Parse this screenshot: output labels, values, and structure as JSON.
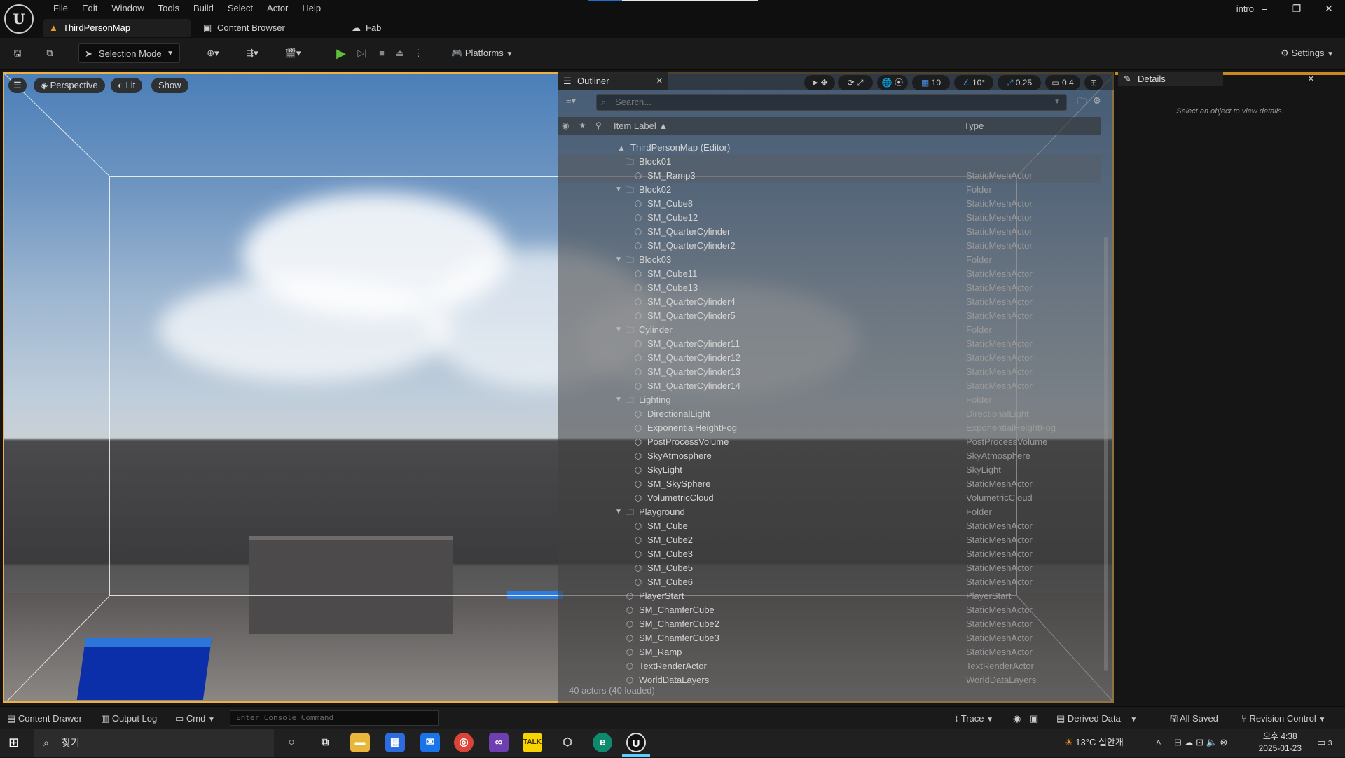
{
  "menu": [
    "File",
    "Edit",
    "Window",
    "Tools",
    "Build",
    "Select",
    "Actor",
    "Help"
  ],
  "tabs": {
    "map": "ThirdPersonMap",
    "content_browser": "Content Browser",
    "fab": "Fab"
  },
  "project_name": "intro",
  "toolbar": {
    "selection_mode": "Selection Mode",
    "platforms": "Platforms",
    "settings": "Settings"
  },
  "viewport": {
    "perspective": "Perspective",
    "lit": "Lit",
    "show": "Show"
  },
  "snap": {
    "grid": "10",
    "rotation": "10°",
    "scale": "0.25",
    "camera_speed": "0.4"
  },
  "outliner": {
    "title": "Outliner",
    "search_placeholder": "Search...",
    "col_label": "Item Label ▲",
    "col_type": "Type",
    "footer": "40 actors (40 loaded)",
    "rows": [
      {
        "label": "ThirdPersonMap (Editor)",
        "type": ""
      },
      {
        "label": "Block01",
        "type": ""
      },
      {
        "label": "SM_Ramp3",
        "type": "StaticMeshActor"
      },
      {
        "label": "Block02",
        "type": "Folder"
      },
      {
        "label": "SM_Cube8",
        "type": "StaticMeshActor"
      },
      {
        "label": "SM_Cube12",
        "type": "StaticMeshActor"
      },
      {
        "label": "SM_QuarterCylinder",
        "type": "StaticMeshActor"
      },
      {
        "label": "SM_QuarterCylinder2",
        "type": "StaticMeshActor"
      },
      {
        "label": "Block03",
        "type": "Folder"
      },
      {
        "label": "SM_Cube11",
        "type": "StaticMeshActor"
      },
      {
        "label": "SM_Cube13",
        "type": "StaticMeshActor"
      },
      {
        "label": "SM_QuarterCylinder4",
        "type": "StaticMeshActor"
      },
      {
        "label": "SM_QuarterCylinder5",
        "type": "StaticMeshActor"
      },
      {
        "label": "Cylinder",
        "type": "Folder"
      },
      {
        "label": "SM_QuarterCylinder11",
        "type": "StaticMeshActor"
      },
      {
        "label": "SM_QuarterCylinder12",
        "type": "StaticMeshActor"
      },
      {
        "label": "SM_QuarterCylinder13",
        "type": "StaticMeshActor"
      },
      {
        "label": "SM_QuarterCylinder14",
        "type": "StaticMeshActor"
      },
      {
        "label": "Lighting",
        "type": "Folder"
      },
      {
        "label": "DirectionalLight",
        "type": "DirectionalLight"
      },
      {
        "label": "ExponentialHeightFog",
        "type": "ExponentialHeightFog"
      },
      {
        "label": "PostProcessVolume",
        "type": "PostProcessVolume"
      },
      {
        "label": "SkyAtmosphere",
        "type": "SkyAtmosphere"
      },
      {
        "label": "SkyLight",
        "type": "SkyLight"
      },
      {
        "label": "SM_SkySphere",
        "type": "StaticMeshActor"
      },
      {
        "label": "VolumetricCloud",
        "type": "VolumetricCloud"
      },
      {
        "label": "Playground",
        "type": "Folder"
      },
      {
        "label": "SM_Cube",
        "type": "StaticMeshActor"
      },
      {
        "label": "SM_Cube2",
        "type": "StaticMeshActor"
      },
      {
        "label": "SM_Cube3",
        "type": "StaticMeshActor"
      },
      {
        "label": "SM_Cube5",
        "type": "StaticMeshActor"
      },
      {
        "label": "SM_Cube6",
        "type": "StaticMeshActor"
      },
      {
        "label": "PlayerStart",
        "type": "PlayerStart"
      },
      {
        "label": "SM_ChamferCube",
        "type": "StaticMeshActor"
      },
      {
        "label": "SM_ChamferCube2",
        "type": "StaticMeshActor"
      },
      {
        "label": "SM_ChamferCube3",
        "type": "StaticMeshActor"
      },
      {
        "label": "SM_Ramp",
        "type": "StaticMeshActor"
      },
      {
        "label": "TextRenderActor",
        "type": "TextRenderActor"
      },
      {
        "label": "WorldDataLayers",
        "type": "WorldDataLayers"
      }
    ]
  },
  "details": {
    "title": "Details",
    "empty": "Select an object to view details."
  },
  "statusbar": {
    "content_drawer": "Content Drawer",
    "output_log": "Output Log",
    "cmd": "Cmd",
    "console_placeholder": "Enter Console Command",
    "trace": "Trace",
    "derived_data": "Derived Data",
    "all_saved": "All Saved",
    "revision_control": "Revision Control"
  },
  "taskbar": {
    "search": "찾기",
    "weather": "13°C  실안개",
    "time": "오후 4:38",
    "date": "2025-01-23",
    "notif": "3"
  }
}
